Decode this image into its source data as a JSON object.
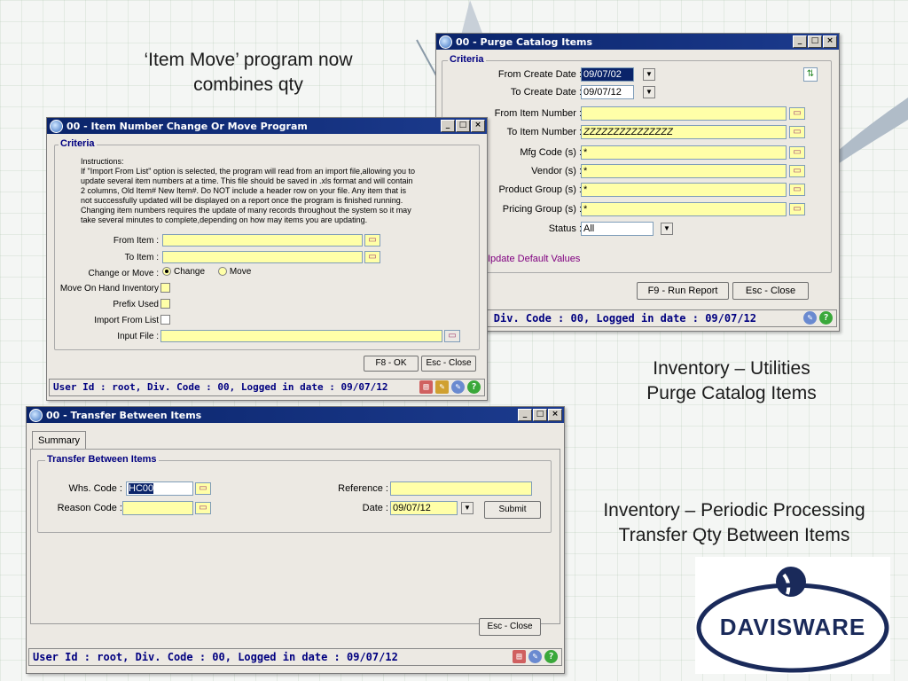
{
  "slide": {
    "caption_top_line1": "‘Item Move’ program now",
    "caption_top_line2": "combines qty",
    "caption_right1_line1": "Inventory – Utilities",
    "caption_right1_line2": "Purge Catalog Items",
    "caption_right2_line1": "Inventory – Periodic Processing",
    "caption_right2_line2": "Transfer Qty Between Items",
    "logo_text": "DAVISWARE",
    "accent": "#1a2a5a"
  },
  "purge": {
    "title": "00 - Purge Catalog Items",
    "criteria": "Criteria",
    "from_create_date_label": "From Create Date :",
    "from_create_date": "09/07/02",
    "to_create_date_label": "To Create Date :",
    "to_create_date": "09/07/12",
    "from_item_label": "From Item Number :",
    "from_item": "",
    "to_item_label": "To Item Number :",
    "to_item": "ZZZZZZZZZZZZZZZ",
    "mfg_label": "Mfg Code (s) :",
    "mfg": "*",
    "vendor_label": "Vendor (s) :",
    "vendor": "*",
    "product_group_label": "Product Group (s) :",
    "product_group": "*",
    "pricing_group_label": "Pricing Group (s) :",
    "pricing_group": "*",
    "status_label": "Status :",
    "status": "All",
    "update_defaults": "Ipdate Default Values",
    "run_button": "F9 - Run Report",
    "close_button": "Esc - Close",
    "status_text": ": root, Div. Code : 00, Logged in date : 09/07/12"
  },
  "move": {
    "title": "00 - Item Number Change Or Move Program",
    "criteria": "Criteria",
    "instructions": [
      "Instructions:",
      "If \"Import From List\" option is selected, the program will read from an import file,allowing you to",
      "update several item numbers at a time. This file should be saved in .xls format and will contain",
      "2 columns, Old Item#  New Item#. Do NOT include a header row on your file. Any item that is",
      "not successfully updated will be displayed on a report once the program is finished running.",
      "Changing item numbers requires the update of many records throughout the system so it may",
      "take several minutes to complete,depending on how may items you are updating."
    ],
    "from_item_label": "From Item :",
    "to_item_label": "To Item :",
    "change_move_label": "Change or Move :",
    "opt_change": "Change",
    "opt_move": "Move",
    "move_on_hand_label": "Move On Hand Inventory",
    "prefix_label": "Prefix Used",
    "import_label": "Import From List",
    "input_file_label": "Input File :",
    "ok_button": "F8 - OK",
    "close_button": "Esc - Close",
    "status_text": "User Id : root, Div. Code : 00, Logged in date : 09/07/12"
  },
  "transfer": {
    "title": "00 - Transfer Between Items",
    "tab": "Summary",
    "group": "Transfer Between Items",
    "whs_label": "Whs. Code :",
    "whs": "HC00",
    "reason_label": "Reason Code :",
    "reason": "",
    "reference_label": "Reference :",
    "reference": "",
    "date_label": "Date :",
    "date": "09/07/12",
    "submit_button": "Submit",
    "close_button": "Esc - Close",
    "status_text": "User Id : root, Div. Code : 00, Logged in date : 09/07/12"
  }
}
